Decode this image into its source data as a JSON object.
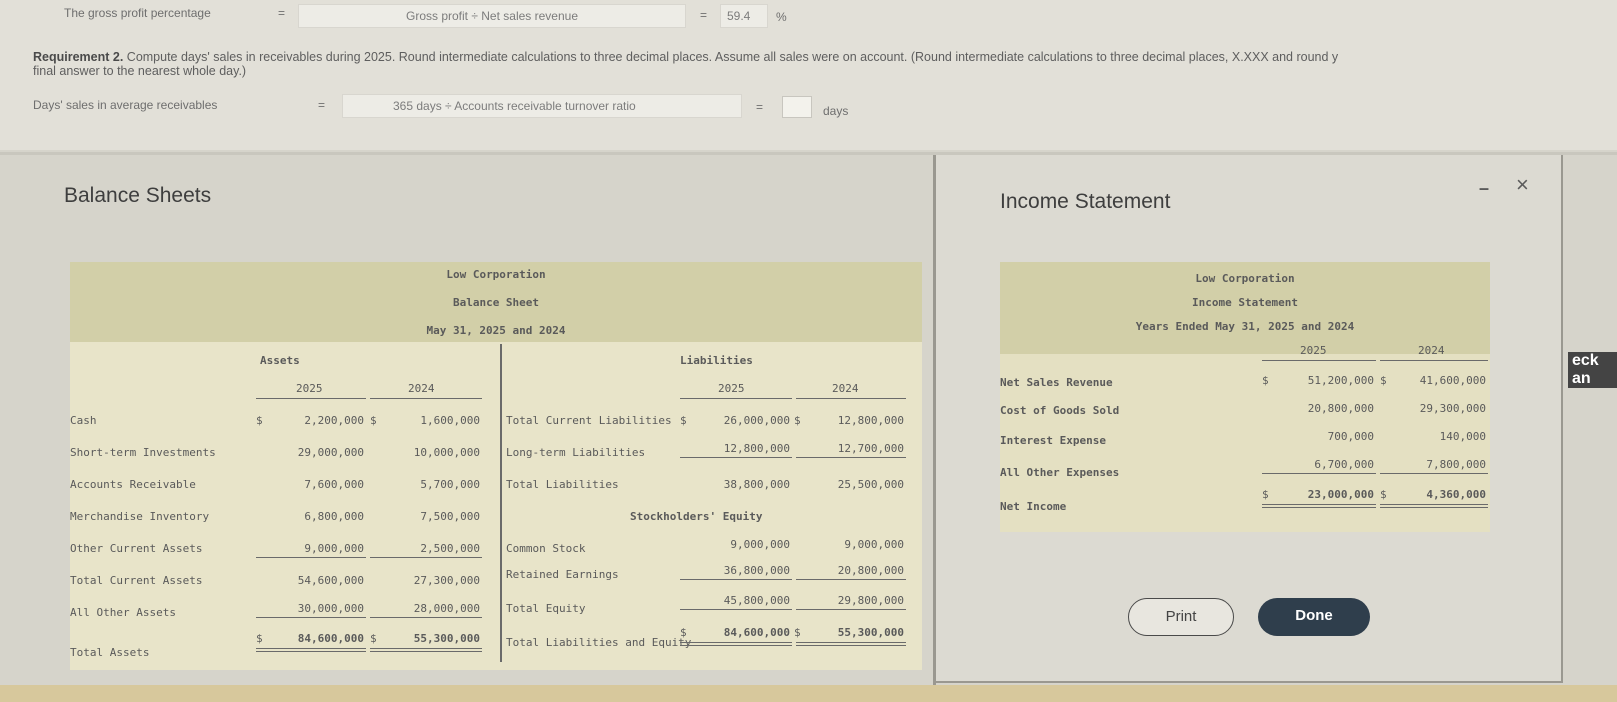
{
  "formula1": {
    "label": "The gross profit percentage",
    "eq": "=",
    "box": "Gross profit ÷ Net sales revenue",
    "eq2": "=",
    "value": "59.4",
    "unit": "%"
  },
  "requirement": {
    "label": "Requirement 2.",
    "text1": " Compute days' sales in receivables during 2025. Round intermediate calculations to three decimal places. Assume all sales were on account. (Round intermediate calculations to three decimal places, X.XXX and round y",
    "text2": "final answer to the nearest whole day.)"
  },
  "formula2": {
    "label": "Days' sales in average receivables",
    "eq": "=",
    "box": "365 days ÷ Accounts receivable turnover ratio",
    "eq2": "=",
    "unit": "days"
  },
  "left_title": "Balance Sheets",
  "right_title": "Income Statement",
  "window": {
    "minimize": "–",
    "close": "×"
  },
  "sidebar_text": "eck an",
  "balance": {
    "company": "Low Corporation",
    "statement": "Balance Sheet",
    "period": "May 31, 2025 and 2024",
    "assets_header": "Assets",
    "liab_header": "Liabilities",
    "year1": "2025",
    "year2": "2024",
    "dollar": "$",
    "assets": [
      {
        "label": "Cash",
        "v1": "2,200,000",
        "v2": "1,600,000"
      },
      {
        "label": "Short-term Investments",
        "v1": "29,000,000",
        "v2": "10,000,000"
      },
      {
        "label": "Accounts Receivable",
        "v1": "7,600,000",
        "v2": "5,700,000"
      },
      {
        "label": "Merchandise Inventory",
        "v1": "6,800,000",
        "v2": "7,500,000"
      },
      {
        "label": "Other Current Assets",
        "v1": "9,000,000",
        "v2": "2,500,000"
      },
      {
        "label": "Total Current Assets",
        "v1": "54,600,000",
        "v2": "27,300,000"
      },
      {
        "label": "All Other Assets",
        "v1": "30,000,000",
        "v2": "28,000,000"
      },
      {
        "label": "Total Assets",
        "v1": "84,600,000",
        "v2": "55,300,000"
      }
    ],
    "liabilities": [
      {
        "label": "Total Current Liabilities",
        "v1": "26,000,000",
        "v2": "12,800,000"
      },
      {
        "label": "Long-term Liabilities",
        "v1": "12,800,000",
        "v2": "12,700,000"
      },
      {
        "label": "Total Liabilities",
        "v1": "38,800,000",
        "v2": "25,500,000"
      }
    ],
    "equity_header": "Stockholders' Equity",
    "equity": [
      {
        "label": "Common Stock",
        "v1": "9,000,000",
        "v2": "9,000,000"
      },
      {
        "label": "Retained Earnings",
        "v1": "36,800,000",
        "v2": "20,800,000"
      },
      {
        "label": "Total Equity",
        "v1": "45,800,000",
        "v2": "29,800,000"
      },
      {
        "label": "Total Liabilities and Equity",
        "v1": "84,600,000",
        "v2": "55,300,000"
      }
    ]
  },
  "income": {
    "company": "Low Corporation",
    "statement": "Income Statement",
    "period": "Years Ended May 31, 2025 and 2024",
    "year1": "2025",
    "year2": "2024",
    "dollar": "$",
    "rows": [
      {
        "label": "Net Sales Revenue",
        "v1": "51,200,000",
        "v2": "41,600,000"
      },
      {
        "label": "Cost of Goods Sold",
        "v1": "20,800,000",
        "v2": "29,300,000"
      },
      {
        "label": "Interest Expense",
        "v1": "700,000",
        "v2": "140,000"
      },
      {
        "label": "All Other Expenses",
        "v1": "6,700,000",
        "v2": "7,800,000"
      },
      {
        "label": "Net Income",
        "v1": "23,000,000",
        "v2": "4,360,000"
      }
    ]
  },
  "buttons": {
    "print": "Print",
    "done": "Done"
  }
}
